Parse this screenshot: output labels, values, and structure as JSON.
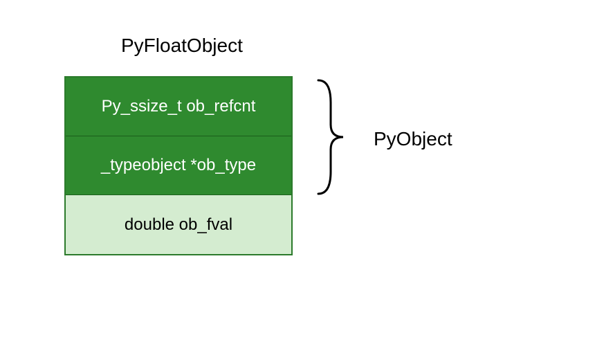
{
  "title": "PyFloatObject",
  "fields": [
    {
      "label": "Py_ssize_t ob_refcnt"
    },
    {
      "label": "_typeobject *ob_type"
    },
    {
      "label": "double ob_fval"
    }
  ],
  "annotation": {
    "label": "PyObject"
  }
}
